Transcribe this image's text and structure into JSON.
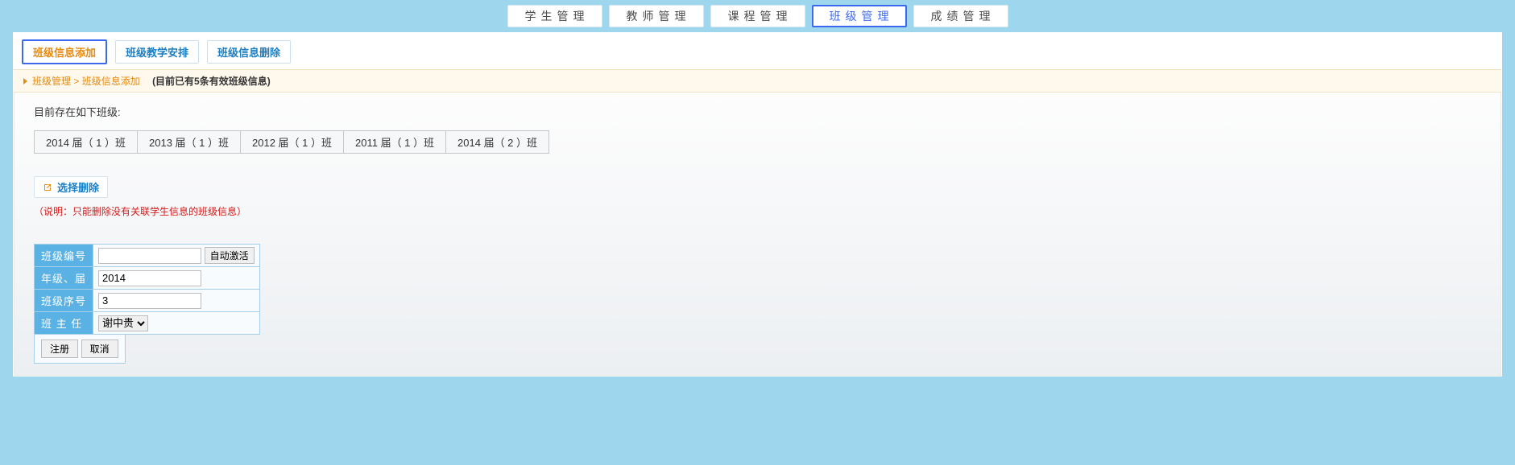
{
  "topnav": [
    {
      "label": "学生管理",
      "active": false
    },
    {
      "label": "教师管理",
      "active": false
    },
    {
      "label": "课程管理",
      "active": false
    },
    {
      "label": "班级管理",
      "active": true
    },
    {
      "label": "成绩管理",
      "active": false
    }
  ],
  "subtabs": [
    {
      "label": "班级信息添加",
      "active": true
    },
    {
      "label": "班级教学安排",
      "active": false
    },
    {
      "label": "班级信息删除",
      "active": false
    }
  ],
  "crumb": {
    "part1": "班级管理",
    "sep": " > ",
    "part2": "班级信息添加",
    "count_text": "(目前已有5条有效班级信息)"
  },
  "content": {
    "caption": "目前存在如下班级:",
    "classes": [
      "2014 届（ 1 ）班",
      "2013 届（ 1 ）班",
      "2012 届（ 1 ）班",
      "2011 届（ 1 ）班",
      "2014 届（ 2 ）班"
    ],
    "select_delete": "选择删除",
    "note": "（说明：只能删除没有关联学生信息的班级信息）"
  },
  "form": {
    "row_class_id": {
      "label": "班级编号",
      "value": "",
      "button": "自动激活"
    },
    "row_grade": {
      "label": "年级、届",
      "value": "2014"
    },
    "row_seq": {
      "label": "班级序号",
      "value": "3"
    },
    "row_teacher": {
      "label": "班 主 任",
      "selected": "谢中贵"
    },
    "submit": "注册",
    "cancel": "取消"
  }
}
